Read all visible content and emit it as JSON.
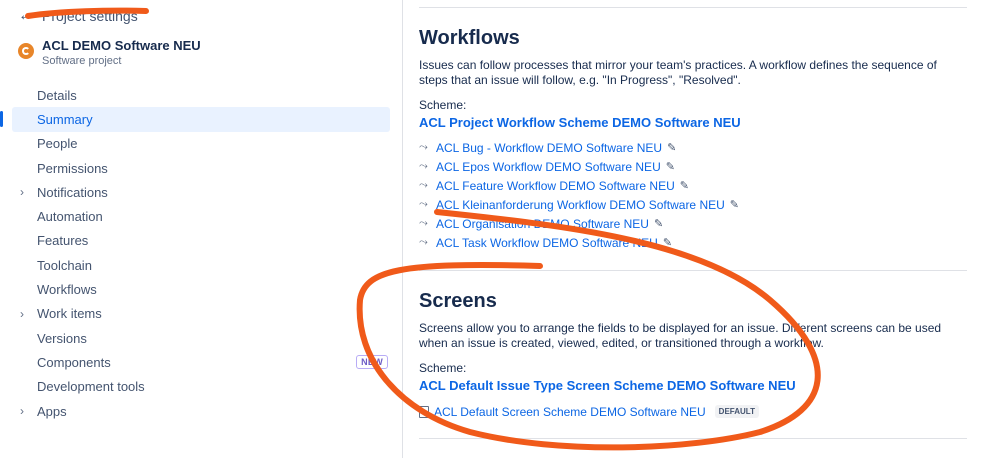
{
  "sidebar": {
    "back_label": "Project settings",
    "project": {
      "name": "ACL DEMO Software NEU",
      "type": "Software project"
    },
    "items": [
      {
        "label": "Details"
      },
      {
        "label": "Summary"
      },
      {
        "label": "People"
      },
      {
        "label": "Permissions"
      },
      {
        "label": "Notifications"
      },
      {
        "label": "Automation"
      },
      {
        "label": "Features"
      },
      {
        "label": "Toolchain"
      },
      {
        "label": "Workflows"
      },
      {
        "label": "Work items"
      },
      {
        "label": "Versions"
      },
      {
        "label": "Components",
        "badge": "NEW"
      },
      {
        "label": "Development tools"
      },
      {
        "label": "Apps"
      }
    ]
  },
  "workflows": {
    "title": "Workflows",
    "description": "Issues can follow processes that mirror your team's practices. A workflow defines the sequence of steps that an issue will follow, e.g. \"In Progress\", \"Resolved\".",
    "scheme_label": "Scheme:",
    "scheme_name": "ACL Project Workflow Scheme DEMO Software NEU",
    "items": [
      "ACL Bug - Workflow DEMO Software NEU",
      "ACL Epos Workflow DEMO Software NEU",
      "ACL Feature Workflow DEMO Software NEU",
      "ACL Kleinanforderung Workflow DEMO Software NEU",
      "ACL Organisation DEMO Software NEU",
      "ACL Task Workflow DEMO Software NEU"
    ]
  },
  "screens": {
    "title": "Screens",
    "description": "Screens allow you to arrange the fields to be displayed for an issue. Different screens can be used when an issue is created, viewed, edited, or transitioned through a workflow.",
    "scheme_label": "Scheme:",
    "scheme_name": "ACL Default Issue Type Screen Scheme DEMO Software NEU",
    "item": "ACL Default Screen Scheme DEMO Software NEU",
    "item_badge": "DEFAULT"
  },
  "colors": {
    "link": "#0c66e4",
    "annotation": "#f05a1a",
    "active_bg": "#e9f2ff"
  }
}
